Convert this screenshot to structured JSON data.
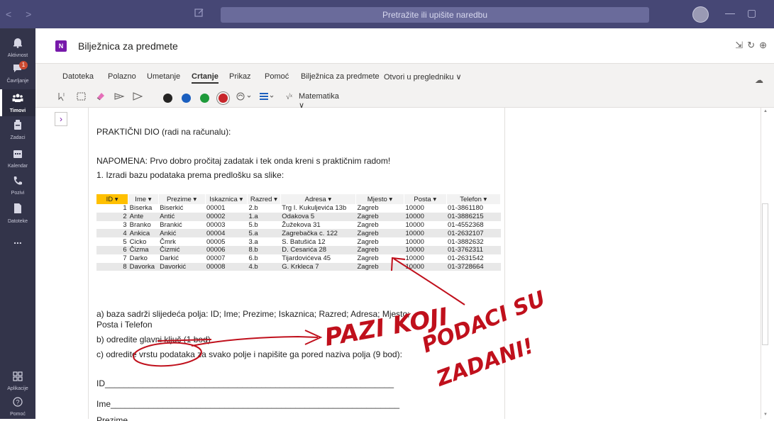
{
  "titlebar": {
    "nav_label": "< >",
    "search_placeholder": "Pretražite ili upišite naredbu",
    "minimize": "—",
    "maximize": "▢"
  },
  "rail": {
    "items": [
      {
        "label": "Aktivnost",
        "icon": "bell-icon"
      },
      {
        "label": "Čavrljanje",
        "icon": "chat-icon",
        "badge": "1"
      },
      {
        "label": "Timovi",
        "icon": "teams-icon"
      },
      {
        "label": "Zadaci",
        "icon": "assignments-icon"
      },
      {
        "label": "Kalendar",
        "icon": "calendar-icon"
      },
      {
        "label": "Pozivi",
        "icon": "phone-icon"
      },
      {
        "label": "Datoteke",
        "icon": "files-icon"
      },
      {
        "label": "...",
        "icon": "more-icon"
      },
      {
        "label": "Aplikacije",
        "icon": "apps-icon"
      },
      {
        "label": "Pomoć",
        "icon": "help-icon"
      }
    ]
  },
  "header": {
    "logo": "N",
    "title": "Bilježnica za predmete"
  },
  "ribbon": {
    "tabs": [
      "Datoteka",
      "Polazno",
      "Umetanje",
      "Crtanje",
      "Prikaz",
      "Pomoć",
      "Bilježnica za predmete",
      "Otvori u pregledniku ∨"
    ],
    "active_tab": "Crtanje",
    "math_label": "Matematika ∨",
    "pen_colors": [
      "#252423",
      "#1b5fbf",
      "#1e9a3a",
      "#c8262b"
    ]
  },
  "note": {
    "line1": "PRAKTIČNI DIO (radi na računalu):",
    "line2": "NAPOMENA: Prvo dobro pročitaj zadatak i tek onda kreni s praktičnim radom!",
    "line3": "1. Izradi bazu podataka prema predlošku sa slike:",
    "qa1": "a) baza sadrži slijedeća polja: ID; Ime; Prezime; Iskaznica; Razred; Adresa; Mjesto;",
    "qa2": "Posta i Telefon",
    "qb": "b) odredite glavni ključ (1 bod)",
    "qc": "c) odredite vrstu podataka za svako polje i napišite ga pored naziva polja (9 bod):",
    "f1": "ID_____________________________________________________________",
    "f2": "Ime_____________________________________________________________",
    "f3": "Prezime"
  },
  "table": {
    "headers": [
      "ID ▾",
      "Ime ▾",
      "Prezime ▾",
      "Iskaznica ▾",
      "Razred ▾",
      "Adresa ▾",
      "Mjesto ▾",
      "Posta ▾",
      "Telefon ▾"
    ],
    "rows": [
      [
        "1",
        "Biserka",
        "Biserkić",
        "00001",
        "2.b",
        "Trg I. Kukuljevića 13b",
        "Zagreb",
        "10000",
        "01-3861180"
      ],
      [
        "2",
        "Ante",
        "Antić",
        "00002",
        "1.a",
        "Odakova 5",
        "Zagreb",
        "10000",
        "01-3886215"
      ],
      [
        "3",
        "Branko",
        "Brankić",
        "00003",
        "5.b",
        "Žužekova 31",
        "Zagreb",
        "10000",
        "01-4552368"
      ],
      [
        "4",
        "Ankica",
        "Ankić",
        "00004",
        "5.a",
        "Zagrebačka c. 122",
        "Zagreb",
        "10000",
        "01-2632107"
      ],
      [
        "5",
        "Cicko",
        "Čmrk",
        "00005",
        "3.a",
        "S. Batušića 12",
        "Zagreb",
        "10000",
        "01-3882632"
      ],
      [
        "6",
        "Čizma",
        "Čizmić",
        "00006",
        "8.b",
        "D. Cesarića 28",
        "Zagreb",
        "10000",
        "01-3762311"
      ],
      [
        "7",
        "Darko",
        "Darkić",
        "00007",
        "6.b",
        "Tijardovićeva 45",
        "Zagreb",
        "10000",
        "01-2631542"
      ],
      [
        "8",
        "Davorka",
        "Davorkić",
        "00008",
        "4.b",
        "G. Krkleca 7",
        "Zagreb",
        "10000",
        "01-3728664"
      ]
    ]
  },
  "ink": {
    "line1": "PAZI KOJI",
    "line2": "PODACI SU",
    "line3": "ZADANI!",
    "color": "#c0101c"
  }
}
